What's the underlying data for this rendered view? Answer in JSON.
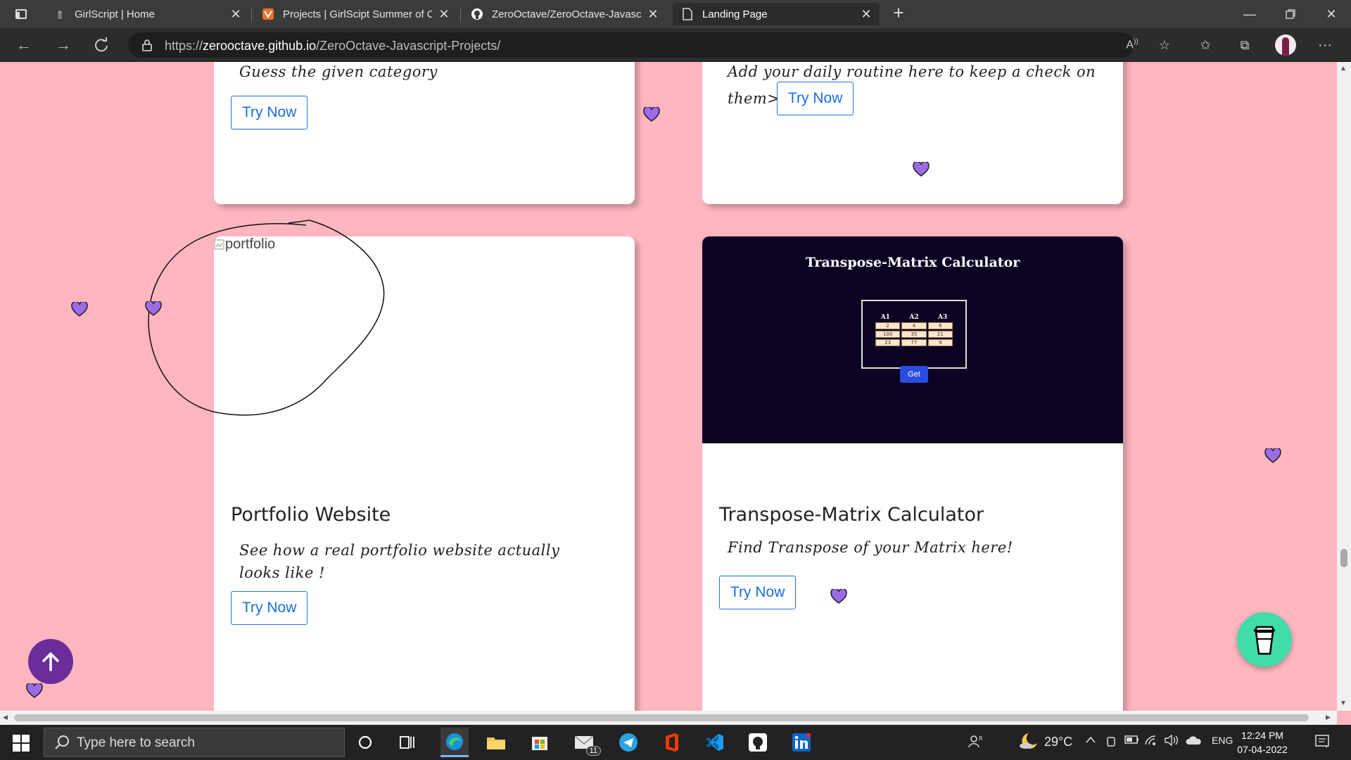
{
  "browser": {
    "tabs": [
      {
        "title": "GirlScript | Home",
        "active": false
      },
      {
        "title": "Projects | GirlScipt Summer of Code",
        "active": false
      },
      {
        "title": "ZeroOctave/ZeroOctave-Javascript",
        "active": false
      },
      {
        "title": "Landing Page",
        "active": true
      }
    ],
    "url_scheme": "https://",
    "url_host": "zerooctave.github.io",
    "url_path": "/ZeroOctave-Javascript-Projects/"
  },
  "cards": {
    "top_left": {
      "description": "Guess the given category",
      "button": "Try Now"
    },
    "top_right": {
      "description_line1": "Add your daily routine here to keep a check on",
      "description_line2": "them>",
      "button": "Try Now"
    },
    "portfolio": {
      "image_alt": "portfolio",
      "title": "Portfolio Website",
      "description": "See how a real portfolio website actually looks like !",
      "button": "Try Now"
    },
    "matrix": {
      "title": "Transpose-Matrix Calculator",
      "description": "Find Transpose of your Matrix here!",
      "button": "Try Now",
      "preview_title": "Transpose-Matrix Calculator",
      "preview_headers": [
        "A1",
        "A2",
        "A3"
      ],
      "preview_rows": [
        [
          "2",
          "4",
          "6"
        ],
        [
          "100",
          "35",
          "21"
        ],
        [
          "23",
          "77",
          "9"
        ]
      ],
      "preview_button": "Get"
    }
  },
  "colors": {
    "page_bg": "#ffb6c1",
    "heart": "#9b6be8",
    "scroll_top_bg": "#6a2d9a",
    "coffee_bg": "#40dcaa",
    "button_blue": "#1a73e8"
  },
  "taskbar": {
    "search_placeholder": "Type here to search",
    "mail_badge": "11",
    "weather": "29°C",
    "language": "ENG",
    "time": "12:24 PM",
    "date": "07-04-2022"
  }
}
